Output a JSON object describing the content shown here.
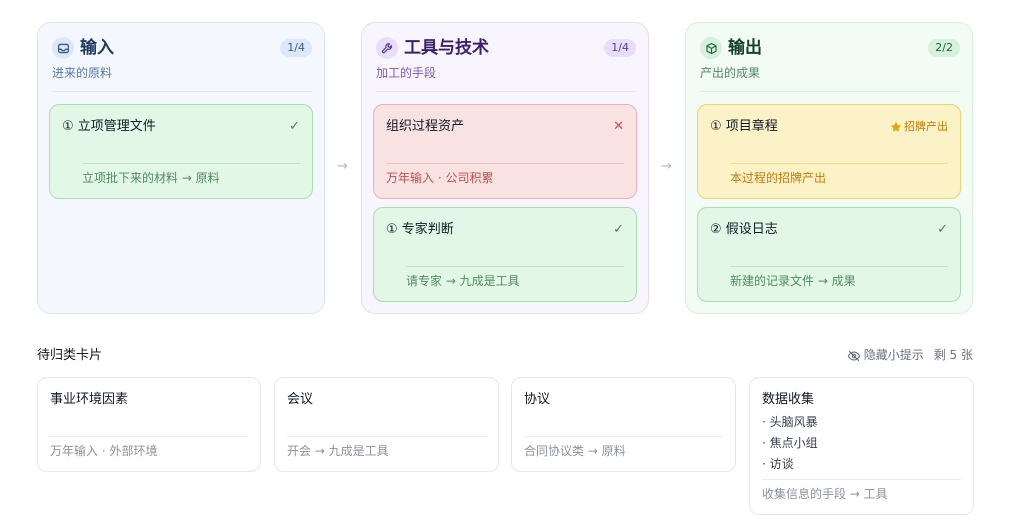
{
  "columns": [
    {
      "icon": "inbox-icon",
      "title": "输入",
      "count": "1/4",
      "subtitle": "进来的原料",
      "cards": [
        {
          "status": "correct",
          "title": "① 立项管理文件",
          "mark": "✓",
          "desc": "立项批下来的材料 → 原料"
        }
      ]
    },
    {
      "icon": "wrench-icon",
      "title": "工具与技术",
      "count": "1/4",
      "subtitle": "加工的手段",
      "cards": [
        {
          "status": "wrong",
          "title": "组织过程资产",
          "mark": "✕",
          "desc": "万年输入 · 公司积累"
        },
        {
          "status": "correct",
          "title": "① 专家判断",
          "mark": "✓",
          "desc": "请专家 → 九成是工具"
        }
      ]
    },
    {
      "icon": "box-icon",
      "title": "输出",
      "count": "2/2",
      "subtitle": "产出的成果",
      "cards": [
        {
          "status": "signature",
          "title": "① 项目章程",
          "mark": "招牌产出",
          "desc": "本过程的招牌产出"
        },
        {
          "status": "correct",
          "title": "② 假设日志",
          "mark": "✓",
          "desc": "新建的记录文件 → 成果"
        }
      ]
    }
  ],
  "pending": {
    "title": "待归类卡片",
    "hide_hint": "隐藏小提示",
    "remaining": "剩 5 张",
    "cards": [
      {
        "title": "事业环境因素",
        "desc": "万年输入 · 外部环境"
      },
      {
        "title": "会议",
        "desc": "开会 → 九成是工具"
      },
      {
        "title": "协议",
        "desc": "合同协议类 → 原料"
      },
      {
        "title": "数据收集",
        "bullets": [
          "· 头脑风暴",
          "· 焦点小组",
          "· 访谈"
        ],
        "desc": "收集信息的手段 → 工具"
      }
    ]
  },
  "colors": {
    "correct": "#e2f7e5",
    "wrong": "#f8e2e2",
    "signature": "#fcf2c7",
    "star": "#e8a20c"
  }
}
